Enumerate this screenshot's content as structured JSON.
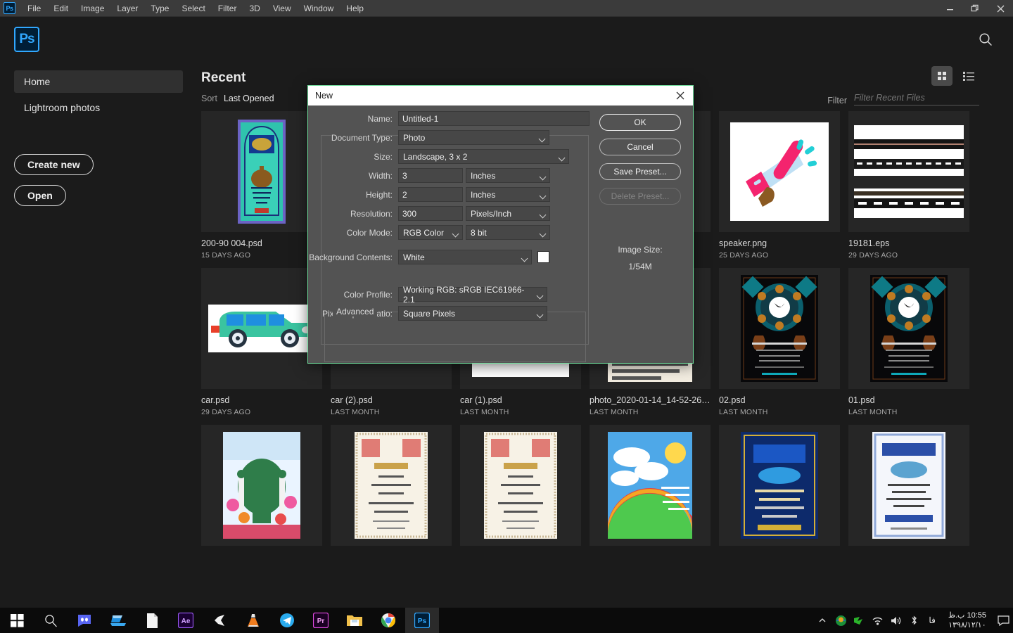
{
  "window": {
    "menus": [
      "File",
      "Edit",
      "Image",
      "Layer",
      "Type",
      "Select",
      "Filter",
      "3D",
      "View",
      "Window",
      "Help"
    ],
    "app_badge": "Ps",
    "controls": {
      "minimize": "minimize-icon",
      "maximize": "maximize-icon",
      "close": "close-icon"
    },
    "search_icon": "search-icon"
  },
  "sidebar": {
    "items": [
      {
        "label": "Home",
        "active": true
      },
      {
        "label": "Lightroom photos",
        "active": false
      }
    ],
    "buttons": [
      {
        "label": "Create new"
      },
      {
        "label": "Open"
      }
    ]
  },
  "recent": {
    "title": "Recent",
    "sort_label": "Sort",
    "sort_value": "Last Opened",
    "filter_label": "Filter",
    "filter_placeholder": "Filter Recent Files",
    "filter_value": "",
    "view_grid_icon": "grid-view-icon",
    "view_list_icon": "list-view-icon",
    "files": [
      {
        "name": "200-90 004.psd",
        "date": "15 DAYS AGO",
        "art": "poster-teal"
      },
      {
        "name": "",
        "date": "",
        "art": "blank-doc"
      },
      {
        "name": "",
        "date": "",
        "art": "blank-doc"
      },
      {
        "name": "",
        "date": "",
        "art": "blank-doc"
      },
      {
        "name": "speaker.png",
        "date": "25 DAYS AGO",
        "art": "megaphone"
      },
      {
        "name": "19181.eps",
        "date": "29 DAYS AGO",
        "art": "road-stripes"
      },
      {
        "name": "car.psd",
        "date": "29 DAYS AGO",
        "art": "car-green"
      },
      {
        "name": "car (2).psd",
        "date": "LAST MONTH",
        "art": "car-red"
      },
      {
        "name": "car (1).psd",
        "date": "LAST MONTH",
        "art": "car-redblue"
      },
      {
        "name": "photo_2020-01-14_14-52-26....",
        "date": "LAST MONTH",
        "art": "poster-photo"
      },
      {
        "name": "02.psd",
        "date": "LAST MONTH",
        "art": "poster-dark"
      },
      {
        "name": "01.psd",
        "date": "LAST MONTH",
        "art": "poster-dark"
      },
      {
        "name": "",
        "date": "",
        "art": "poster-green-dome"
      },
      {
        "name": "",
        "date": "",
        "art": "certificate"
      },
      {
        "name": "",
        "date": "",
        "art": "certificate"
      },
      {
        "name": "",
        "date": "",
        "art": "poster-rainbow"
      },
      {
        "name": "",
        "date": "",
        "art": "poster-blue"
      },
      {
        "name": "",
        "date": "",
        "art": "certificate-blue"
      }
    ]
  },
  "dialog": {
    "title": "New",
    "close_icon": "close-icon",
    "fields": {
      "name_label": "Name:",
      "name_value": "Untitled-1",
      "doctype_label": "Document Type:",
      "doctype_value": "Photo",
      "size_label": "Size:",
      "size_value": "Landscape, 3 x 2",
      "width_label": "Width:",
      "width_value": "3",
      "width_unit": "Inches",
      "height_label": "Height:",
      "height_value": "2",
      "height_unit": "Inches",
      "resolution_label": "Resolution:",
      "resolution_value": "300",
      "resolution_unit": "Pixels/Inch",
      "colormode_label": "Color Mode:",
      "colormode_value": "RGB Color",
      "colordepth_value": "8 bit",
      "background_label": "Background Contents:",
      "background_value": "White",
      "background_swatch": "#ffffff",
      "advanced_legend": "Advanced",
      "colorprofile_label": "Color Profile:",
      "colorprofile_value": "Working RGB:  sRGB IEC61966-2.1",
      "aspect_label": "Pixel Aspect Ratio:",
      "aspect_value": "Square Pixels"
    },
    "buttons": {
      "ok": "OK",
      "cancel": "Cancel",
      "save_preset": "Save Preset...",
      "delete_preset": "Delete Preset..."
    },
    "image_size_label": "Image Size:",
    "image_size_value": "1/54M"
  },
  "taskbar": {
    "apps": [
      {
        "icon": "windows-start-icon",
        "name": "start-button"
      },
      {
        "icon": "search-icon",
        "name": "taskbar-search"
      },
      {
        "icon": "discord-icon",
        "name": "discord"
      },
      {
        "icon": "laptop-icon",
        "name": "laptop-app"
      },
      {
        "icon": "document-icon",
        "name": "document-app"
      },
      {
        "icon": "after-effects-icon",
        "name": "after-effects",
        "label": "Ae"
      },
      {
        "icon": "unity-icon",
        "name": "unity"
      },
      {
        "icon": "vlc-icon",
        "name": "vlc"
      },
      {
        "icon": "telegram-icon",
        "name": "telegram"
      },
      {
        "icon": "premiere-icon",
        "name": "premiere",
        "label": "Pr"
      },
      {
        "icon": "file-explorer-icon",
        "name": "file-explorer"
      },
      {
        "icon": "chrome-icon",
        "name": "chrome"
      },
      {
        "icon": "photoshop-icon",
        "name": "photoshop",
        "label": "Ps"
      }
    ],
    "tray": {
      "chevron": "show-hidden-icons",
      "icons": [
        "idm-icon",
        "nvidia-icon",
        "wifi-icon",
        "volume-icon",
        "bluetooth-icon"
      ],
      "language": "فا",
      "time": "10:55 ب.ظ",
      "date": "۱۳۹۸/۱۲/۱۰",
      "notifications": "notification-icon"
    }
  },
  "colors": {
    "accent": "#31a8ff",
    "dialog_border": "#6fdc9b",
    "app_bg": "#1b1b1b",
    "dialog_bg": "#535353"
  }
}
